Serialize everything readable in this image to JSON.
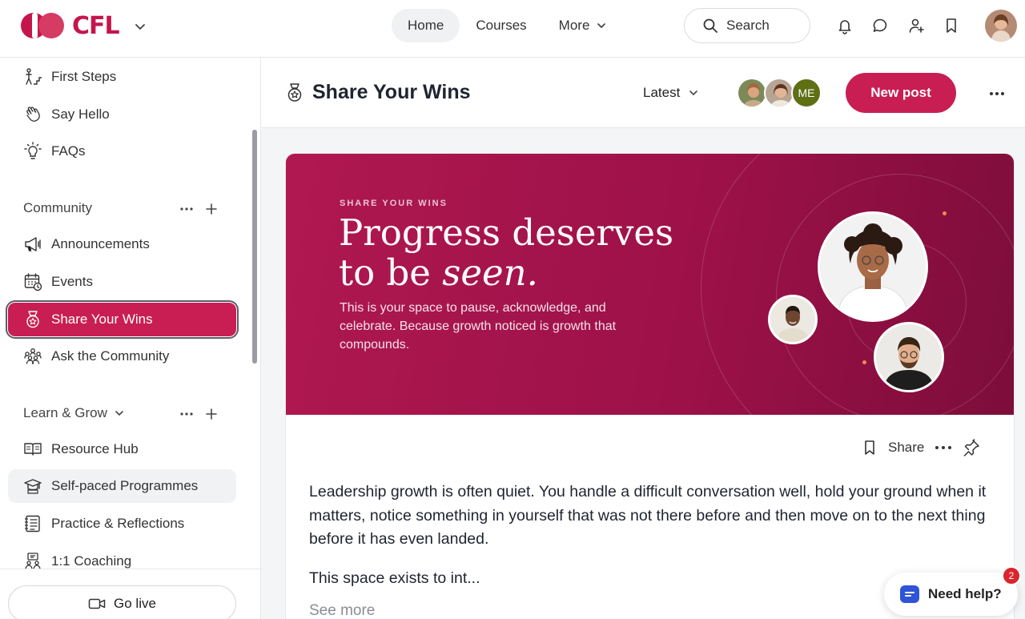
{
  "brand": {
    "name": "CFL",
    "primary_color": "#c81e53"
  },
  "nav": {
    "items": [
      {
        "label": "Home",
        "active": true
      },
      {
        "label": "Courses",
        "active": false
      },
      {
        "label": "More",
        "active": false
      }
    ]
  },
  "search": {
    "label": "Search"
  },
  "top_icons": [
    "bell-icon",
    "chat-icon",
    "add-person-icon",
    "bookmark-icon"
  ],
  "sidebar": {
    "top_items": [
      {
        "label": "First Steps",
        "icon": "steps-icon"
      },
      {
        "label": "Say Hello",
        "icon": "wave-icon"
      },
      {
        "label": "FAQs",
        "icon": "lightbulb-icon"
      }
    ],
    "community": {
      "title": "Community",
      "items": [
        {
          "label": "Announcements",
          "icon": "megaphone-icon"
        },
        {
          "label": "Events",
          "icon": "calendar-icon"
        },
        {
          "label": "Share Your Wins",
          "icon": "medal-icon",
          "active": true
        },
        {
          "label": "Ask the Community",
          "icon": "people-icon"
        }
      ]
    },
    "learn": {
      "title": "Learn & Grow",
      "items": [
        {
          "label": "Resource Hub",
          "icon": "book-icon"
        },
        {
          "label": "Self-paced Programmes",
          "icon": "graduation-cap-icon"
        },
        {
          "label": "Practice & Reflections",
          "icon": "notebook-icon"
        },
        {
          "label": "1:1 Coaching",
          "icon": "coaching-icon"
        }
      ]
    },
    "go_live": "Go live"
  },
  "space": {
    "title": "Share Your Wins",
    "sort": "Latest",
    "member_initials": "ME",
    "new_post": "New post"
  },
  "post": {
    "banner": {
      "eyebrow": "SHARE YOUR WINS",
      "headline_line1": "Progress deserves",
      "headline_line2a": "to be ",
      "headline_line2b": "seen.",
      "subtext": "This is your space to pause, acknowledge, and celebrate. Because growth noticed is growth that compounds."
    },
    "actions": {
      "share": "Share"
    },
    "body_paragraph": "Leadership growth is often quiet. You handle a difficult conversation well, hold your ground when it matters, notice something in yourself that was not there before and then move on to the next thing before it has even landed.",
    "body_truncated": "This space exists to int...",
    "see_more": "See more"
  },
  "help": {
    "label": "Need help?",
    "badge_count": "2"
  }
}
